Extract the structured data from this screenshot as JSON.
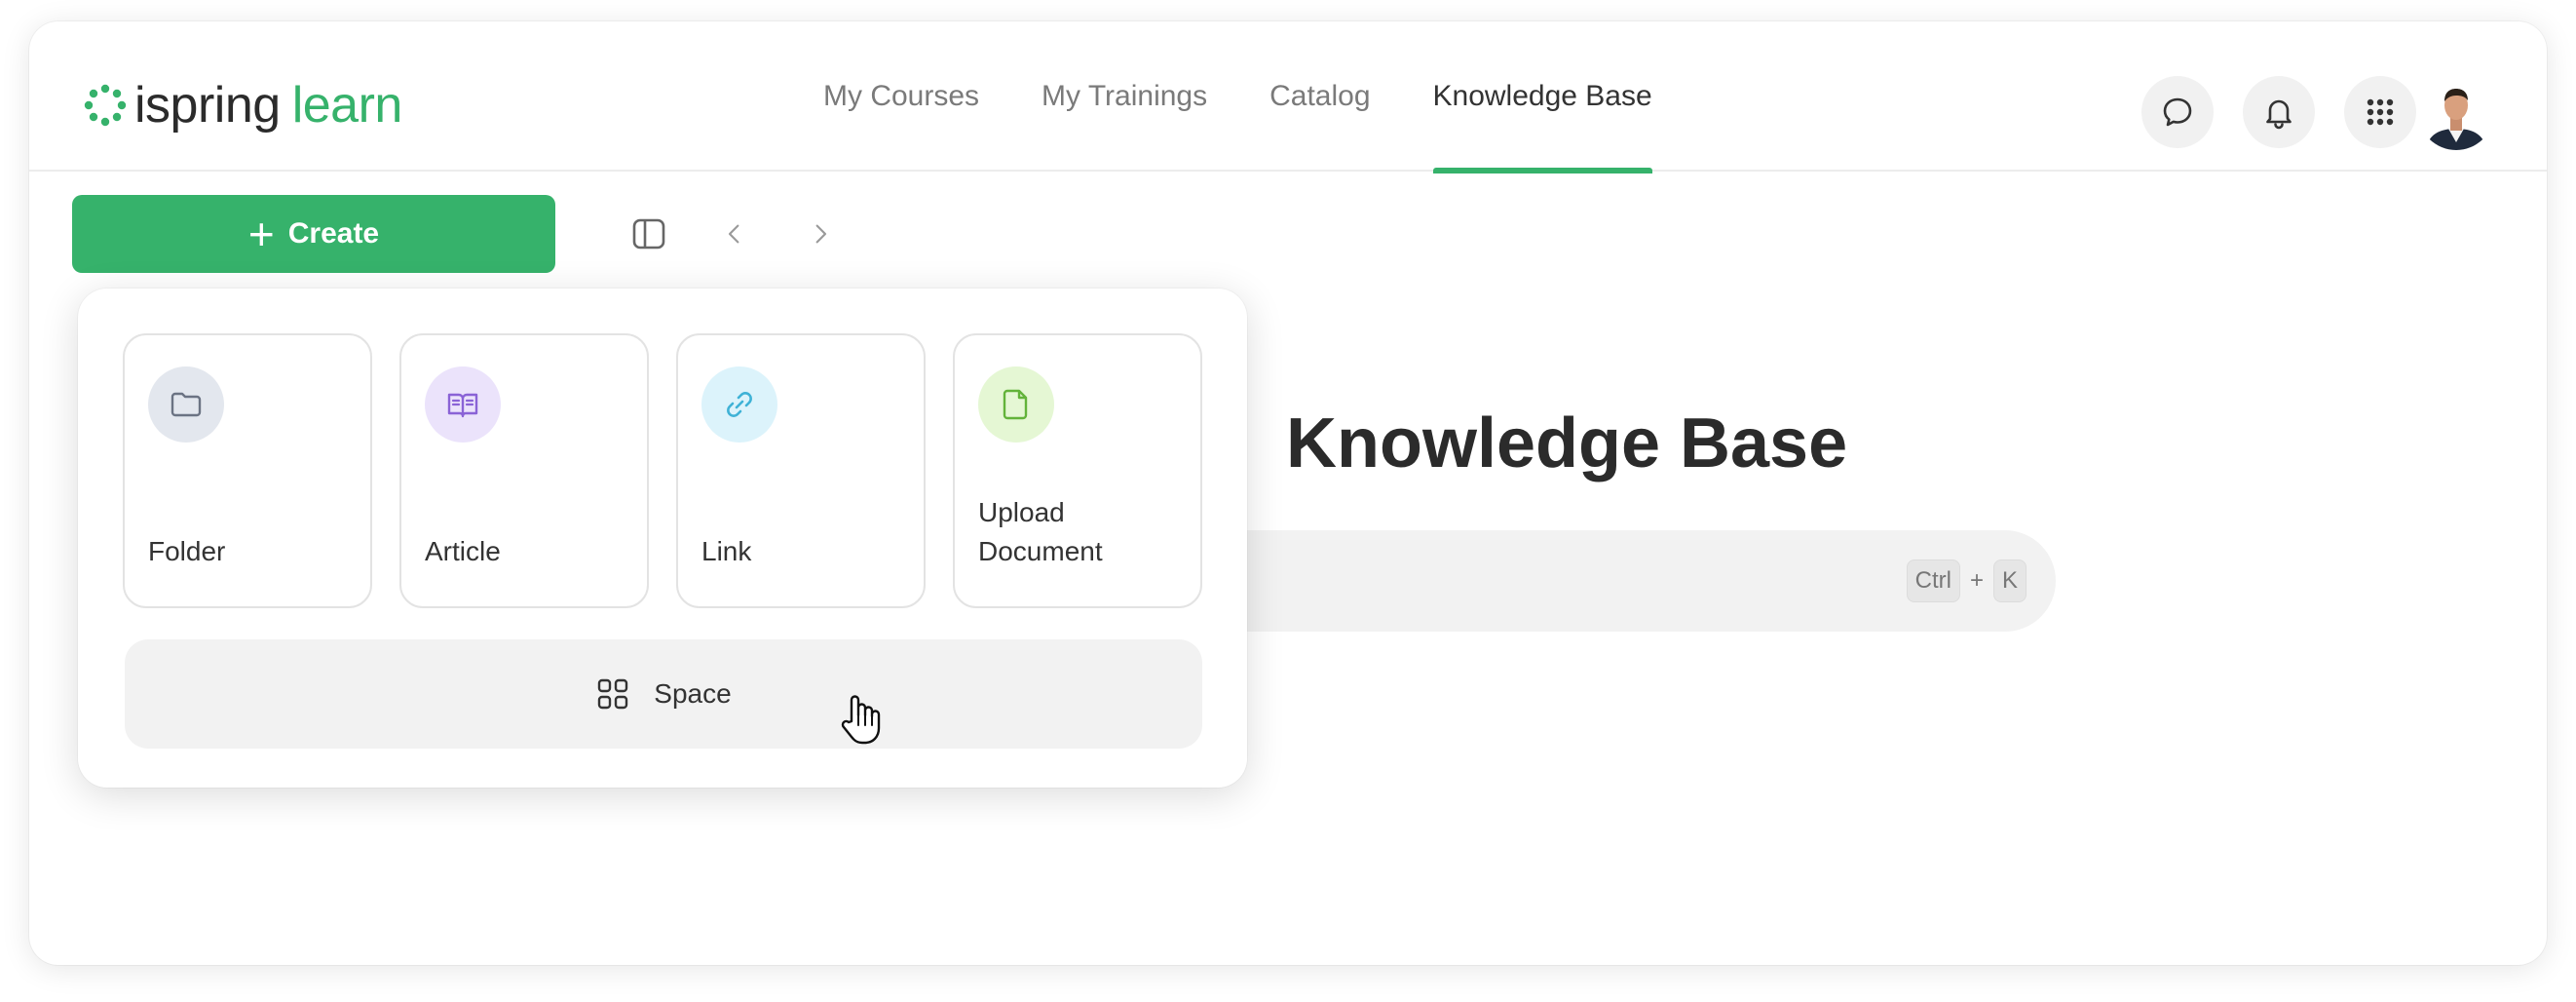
{
  "app": {
    "logo_word1": "ispring",
    "logo_word2": "learn",
    "brand_color": "#36b26b"
  },
  "nav": {
    "items": [
      {
        "label": "My Courses",
        "active": false
      },
      {
        "label": "My Trainings",
        "active": false
      },
      {
        "label": "Catalog",
        "active": false
      },
      {
        "label": "Knowledge Base",
        "active": true
      }
    ]
  },
  "header_actions": {
    "icons": [
      "chat-icon",
      "bell-icon",
      "apps-grid-icon",
      "avatar"
    ]
  },
  "toolbar": {
    "create_label": "Create",
    "icons": [
      "sidebar-toggle-icon",
      "chevron-left-icon",
      "chevron-right-icon"
    ]
  },
  "main": {
    "title": "Knowledge Base",
    "shortcut": {
      "key1": "Ctrl",
      "plus": "+",
      "key2": "K"
    }
  },
  "create_menu": {
    "cards": [
      {
        "label": "Folder",
        "icon": "folder-icon",
        "icon_bg": "#e3e7ee",
        "icon_color": "#6b7383"
      },
      {
        "label": "Article",
        "icon": "book-icon",
        "icon_bg": "#ebe3fb",
        "icon_color": "#8a63d6"
      },
      {
        "label": "Link",
        "icon": "link-icon",
        "icon_bg": "#dcf3fb",
        "icon_color": "#3fb2d6"
      },
      {
        "label": "Upload Document",
        "icon": "document-icon",
        "icon_bg": "#e5f7d4",
        "icon_color": "#63b33a"
      }
    ],
    "space_label": "Space"
  }
}
